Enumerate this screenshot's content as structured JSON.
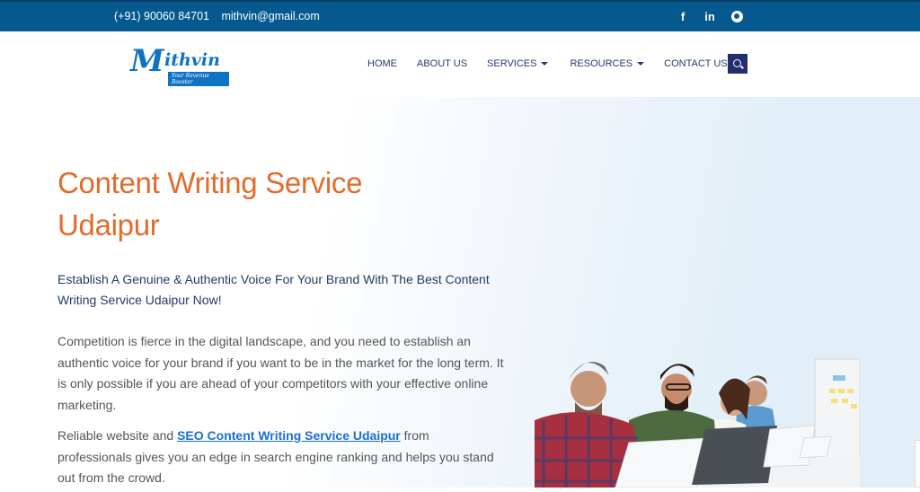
{
  "topbar": {
    "phone": "(+91) 90060 84701",
    "email": "mithvin@gmail.com",
    "social": [
      {
        "name": "facebook-icon",
        "glyph": "f"
      },
      {
        "name": "linkedin-icon",
        "glyph": "in"
      },
      {
        "name": "whatsapp-icon",
        "glyph": ""
      }
    ]
  },
  "logo": {
    "mark": "M",
    "word": "ithvin",
    "tagline": "Your Revenue Booster"
  },
  "nav": {
    "items": [
      {
        "label": "HOME",
        "dropdown": false
      },
      {
        "label": "ABOUT US",
        "dropdown": false
      },
      {
        "label": "SERVICES",
        "dropdown": true
      },
      {
        "label": "RESOURCES",
        "dropdown": true
      },
      {
        "label": "CONTACT US",
        "dropdown": false
      }
    ],
    "search_icon": "search-icon"
  },
  "hero": {
    "title": "Content Writing Service Udaipur",
    "subtitle": "Establish A Genuine & Authentic Voice For Your Brand With The Best Content Writing Service Udaipur Now!",
    "paragraph1": "Competition is fierce in the digital landscape, and you need to establish an authentic voice for your brand if you want to be in the market for the long term. It is only possible if you are ahead of your competitors with your effective online marketing.",
    "paragraph2_before": "Reliable website and ",
    "paragraph2_link": "SEO Content Writing Service Udaipur",
    "paragraph2_after": " from professionals gives you an edge in search engine ranking and helps you stand out from the crowd.",
    "image_alt": "Team of content writers working on laptops"
  },
  "colors": {
    "topbar": "#05598f",
    "accent_orange": "#e36b2c",
    "nav_text": "#243a6b",
    "search_bg": "#232e6f",
    "link": "#1a6fd1"
  }
}
